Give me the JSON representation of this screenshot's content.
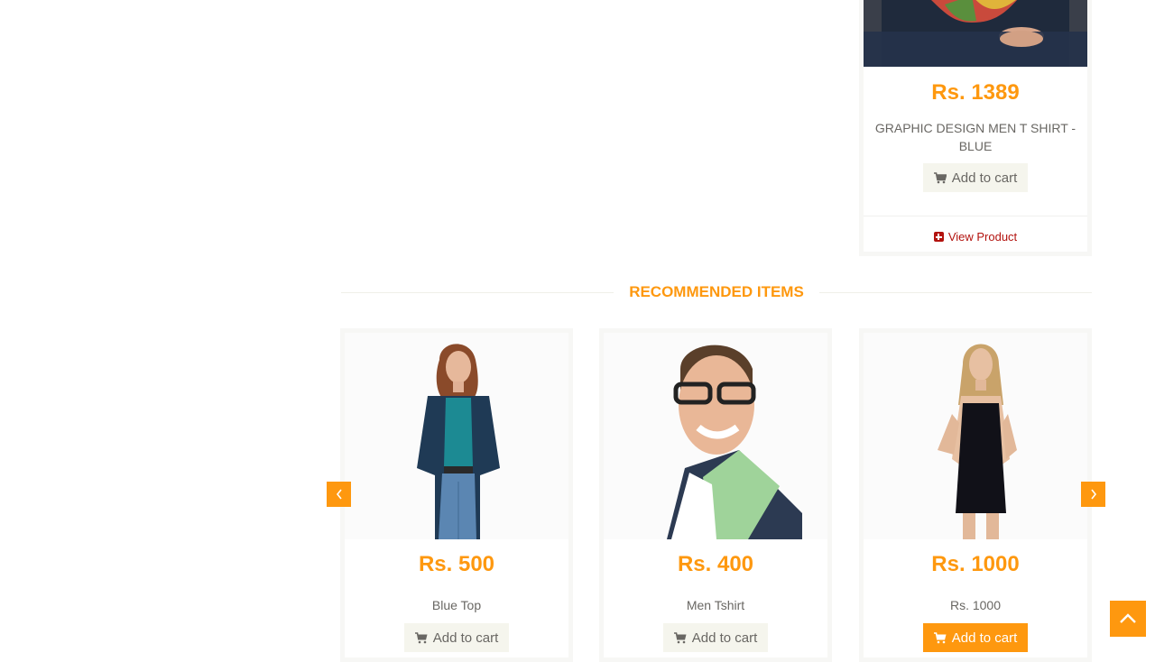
{
  "top_product": {
    "price": "Rs. 1389",
    "name": "GRAPHIC DESIGN MEN T SHIRT - BLUE",
    "add_to_cart": "Add to cart",
    "view_product": "View Product"
  },
  "recommended": {
    "title": "RECOMMENDED ITEMS",
    "items": [
      {
        "price": "Rs. 500",
        "name": "Blue Top",
        "add_to_cart": "Add to cart"
      },
      {
        "price": "Rs. 400",
        "name": "Men Tshirt",
        "add_to_cart": "Add to cart"
      },
      {
        "price": "Rs. 1000",
        "name": "Rs. 1000",
        "add_to_cart": "Add to cart"
      }
    ],
    "prev_icon": "chevron-left-icon",
    "next_icon": "chevron-right-icon"
  },
  "scroll_up_icon": "chevron-up-icon",
  "colors": {
    "accent": "#FE980F",
    "button_bg": "#F5F5ED",
    "view_link": "#B3130F"
  }
}
